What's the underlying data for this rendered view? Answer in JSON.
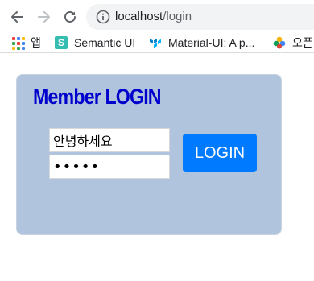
{
  "browser": {
    "url_host": "localhost",
    "url_path": "/login",
    "bookmarks": {
      "apps_label": "앱",
      "items": [
        {
          "label": "Semantic UI",
          "icon": "semantic-ui-logo"
        },
        {
          "label": "Material-UI: A p...",
          "icon": "material-ui-logo"
        },
        {
          "label": "오픈",
          "icon": "colorful-flower-logo"
        }
      ]
    }
  },
  "login": {
    "title": "Member LOGIN",
    "username_value": "안녕하세요",
    "password_value": "•••••",
    "button_label": "LOGIN"
  },
  "colors": {
    "panel_bg": "#b0c4de",
    "title": "#0000cd",
    "button_bg": "#007bff"
  }
}
